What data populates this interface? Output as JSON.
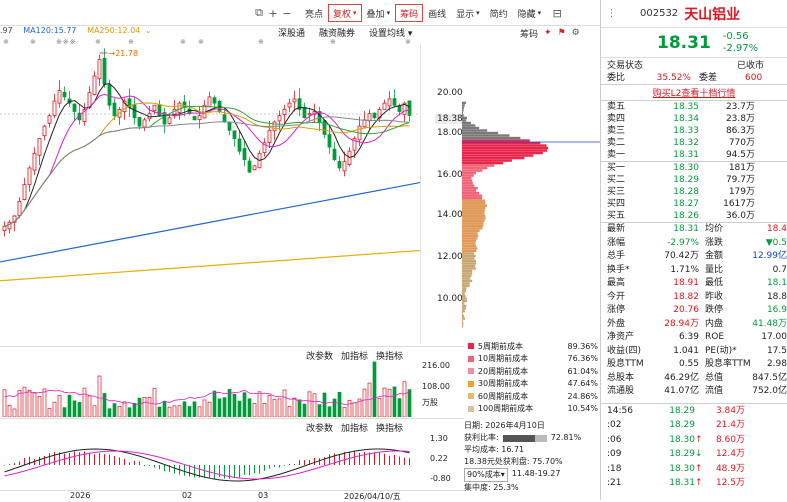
{
  "toolbar": {
    "items": [
      {
        "label": "亮点",
        "variant": "plain"
      },
      {
        "label": "复权",
        "variant": "red"
      },
      {
        "label": "叠加",
        "variant": "plain"
      },
      {
        "label": "筹码",
        "variant": "red"
      },
      {
        "label": "画线",
        "variant": "plain"
      },
      {
        "label": "显示",
        "variant": "plain"
      },
      {
        "label": "简约",
        "variant": "plain"
      },
      {
        "label": "隐藏",
        "variant": "plain"
      }
    ]
  },
  "ma_legend": [
    {
      "text": ".97",
      "color": "#444444"
    },
    {
      "text": "MA120:15.77",
      "color": "#1d66d6"
    },
    {
      "text": "MA250:12.04",
      "color": "#e09a00"
    }
  ],
  "chart_header_links": [
    "深股通",
    "融资融券",
    "设置均线"
  ],
  "chips_header_tag": "筹码",
  "price_axis": [
    "20.00",
    "18.38",
    "18.00",
    "16.00",
    "14.00",
    "12.00",
    "10.00"
  ],
  "price_highlight": "18.38",
  "price_marker": "21.78",
  "vol_toolbar": [
    "改参数",
    "加指标",
    "换指标"
  ],
  "vol_axis": [
    "216.00",
    "108.00",
    "万股"
  ],
  "macd_toolbar": [
    "改参数",
    "加指标",
    "换指标"
  ],
  "macd_axis": [
    "1.30",
    "0.22",
    "-0.80"
  ],
  "x_labels": [
    "2026",
    "02",
    "03",
    "2026/04/10/五"
  ],
  "cost_legend": [
    {
      "label": "5周期前成本",
      "pct": "89.36%",
      "color": "#e8264b"
    },
    {
      "label": "10周期前成本",
      "pct": "76.36%",
      "color": "#f06678"
    },
    {
      "label": "20周期前成本",
      "pct": "61.04%",
      "color": "#f08fa0"
    },
    {
      "label": "30周期前成本",
      "pct": "47.64%",
      "color": "#f0a030"
    },
    {
      "label": "60周期前成本",
      "pct": "24.86%",
      "color": "#e6b870"
    },
    {
      "label": "100周期前成本",
      "pct": "10.54%",
      "color": "#d8c4a0"
    }
  ],
  "chip_info": {
    "date": "日期: 2026年4月10日",
    "profit_label": "获利比率:",
    "profit": "72.81%",
    "avg_cost": "平均成本: 16.71",
    "at_price": "18.38元处获利盘: 75.70%",
    "range_select": "90%成本",
    "range": "11.48-19.27",
    "concentration": "集中度: 25.3%"
  },
  "quote": {
    "code": "002532",
    "name": "天山铝业",
    "price": "18.31",
    "change": "-0.56",
    "change_pct": "-2.97%",
    "trade_status_label": "交易状态",
    "trade_status": "已收市",
    "weibi_label": "委比",
    "weibi": "35.52%",
    "weicha_label": "委差",
    "weicha": "600",
    "l2_link": "购买L2查看十档行情"
  },
  "sell": [
    {
      "label": "卖五",
      "price": "18.35",
      "vol": "23.7万"
    },
    {
      "label": "卖四",
      "price": "18.34",
      "vol": "23.8万"
    },
    {
      "label": "卖三",
      "price": "18.33",
      "vol": "86.3万"
    },
    {
      "label": "卖二",
      "price": "18.32",
      "vol": "770万"
    },
    {
      "label": "卖一",
      "price": "18.31",
      "vol": "94.5万"
    }
  ],
  "buy": [
    {
      "label": "买一",
      "price": "18.30",
      "vol": "181万"
    },
    {
      "label": "买二",
      "price": "18.29",
      "vol": "79.7万"
    },
    {
      "label": "买三",
      "price": "18.28",
      "vol": "179万"
    },
    {
      "label": "买四",
      "price": "18.27",
      "vol": "1617万"
    },
    {
      "label": "买五",
      "price": "18.26",
      "vol": "36.0万"
    }
  ],
  "stats": [
    {
      "l1": "最新",
      "v1": "18.31",
      "c1": "grn",
      "l2": "均价",
      "v2": "18.4",
      "c2": "red"
    },
    {
      "l1": "涨幅",
      "v1": "-2.97%",
      "c1": "grn",
      "l2": "涨跌",
      "v2": "▼0.5",
      "c2": "grn"
    },
    {
      "l1": "总手",
      "v1": "70.42万",
      "c1": "dark",
      "l2": "金额",
      "v2": "12.99亿",
      "c2": "blu"
    },
    {
      "l1": "换手*",
      "v1": "1.71%",
      "c1": "dark",
      "l2": "量比",
      "v2": "0.7",
      "c2": "dark"
    },
    {
      "l1": "最高",
      "v1": "18.91",
      "c1": "red",
      "l2": "最低",
      "v2": "18.1",
      "c2": "grn"
    },
    {
      "l1": "今开",
      "v1": "18.82",
      "c1": "red",
      "l2": "昨收",
      "v2": "18.8",
      "c2": "dark"
    },
    {
      "l1": "涨停",
      "v1": "20.76",
      "c1": "red",
      "l2": "跌停",
      "v2": "16.9",
      "c2": "grn"
    },
    {
      "l1": "外盘",
      "v1": "28.94万",
      "c1": "red",
      "l2": "内盘",
      "v2": "41.48万",
      "c2": "grn"
    },
    {
      "l1": "净资产",
      "v1": "6.39",
      "c1": "dark",
      "l2": "ROE",
      "v2": "17.00",
      "c2": "dark"
    },
    {
      "l1": "收益(四)",
      "v1": "1.041",
      "c1": "dark",
      "l2": "PE(动)*",
      "v2": "17.5",
      "c2": "dark"
    },
    {
      "l1": "股息TTM",
      "v1": "0.55",
      "c1": "dark",
      "l2": "股息率TTM",
      "v2": "2.98",
      "c2": "dark"
    },
    {
      "l1": "总股本",
      "v1": "46.29亿",
      "c1": "dark",
      "l2": "总值",
      "v2": "847.5亿",
      "c2": "dark"
    },
    {
      "l1": "流通股",
      "v1": "41.07亿",
      "c1": "dark",
      "l2": "流值",
      "v2": "752.0亿",
      "c2": "dark"
    }
  ],
  "ticks": [
    {
      "time": "14:56",
      "price": "18.29",
      "vol": "3.84万",
      "dir": ""
    },
    {
      "time": ":02",
      "price": "18.29",
      "vol": "21.4万",
      "dir": ""
    },
    {
      "time": ":06",
      "price": "18.30",
      "vol": "8.60万",
      "dir": "↑"
    },
    {
      "time": ":09",
      "price": "18.29",
      "vol": "12.4万",
      "dir": "↓"
    },
    {
      "time": ":18",
      "price": "18.30",
      "vol": "48.9万",
      "dir": "↑"
    },
    {
      "time": ":21",
      "price": "18.31",
      "vol": "12.5万",
      "dir": "↑"
    }
  ]
}
